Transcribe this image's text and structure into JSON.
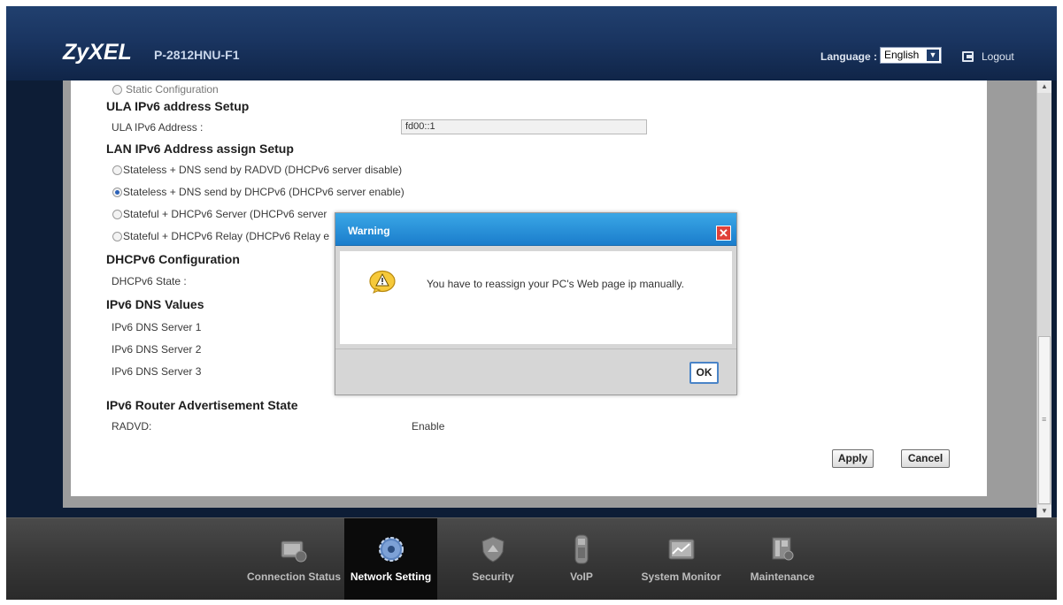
{
  "header": {
    "logo": "ZyXEL",
    "model": "P-2812HNU-F1",
    "language_label": "Language :",
    "language_value": "English",
    "logout_label": "Logout"
  },
  "form": {
    "static_config_label": "Static Configuration",
    "ula_section": "ULA IPv6 address Setup",
    "ula_address_label": "ULA IPv6 Address :",
    "ula_address_value": "fd00::1",
    "lan_section": "LAN IPv6 Address assign Setup",
    "lan_options": [
      {
        "label": "Stateless + DNS send by RADVD (DHCPv6 server disable)",
        "selected": false
      },
      {
        "label": "Stateless + DNS send by DHCPv6 (DHCPv6 server enable)",
        "selected": true
      },
      {
        "label": "Stateful + DHCPv6 Server (DHCPv6 server",
        "selected": false
      },
      {
        "label": "Stateful + DHCPv6 Relay (DHCPv6 Relay e",
        "selected": false
      }
    ],
    "dhcp_section": "DHCPv6 Configuration",
    "dhcp_state_label": "DHCPv6 State :",
    "dns_section": "IPv6 DNS Values",
    "dns_servers": [
      "IPv6 DNS Server 1",
      "IPv6 DNS Server 2",
      "IPv6 DNS Server 3"
    ],
    "ra_section": "IPv6 Router Advertisement State",
    "radvd_label": "RADVD:",
    "radvd_value": "Enable",
    "apply_label": "Apply",
    "cancel_label": "Cancel"
  },
  "dialog": {
    "title": "Warning",
    "close_glyph": "✕",
    "message": "You have to reassign your PC's Web page ip manually.",
    "ok_label": "OK"
  },
  "nav": {
    "items": [
      {
        "label": "Connection Status",
        "icon": "connection-status-icon",
        "active": false
      },
      {
        "label": "Network Setting",
        "icon": "network-setting-icon",
        "active": true
      },
      {
        "label": "Security",
        "icon": "security-icon",
        "active": false
      },
      {
        "label": "VoIP",
        "icon": "voip-icon",
        "active": false
      },
      {
        "label": "System Monitor",
        "icon": "system-monitor-icon",
        "active": false
      },
      {
        "label": "Maintenance",
        "icon": "maintenance-icon",
        "active": false
      }
    ]
  },
  "colors": {
    "header_bg": "#1a3561",
    "dialog_title_bg": "#1b7dcc",
    "content_bg": "#9c9c9c",
    "nav_bg": "#383838"
  }
}
